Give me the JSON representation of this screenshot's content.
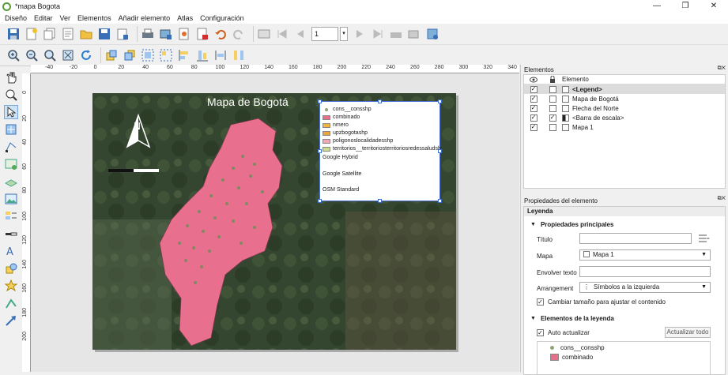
{
  "window": {
    "title": "*mapa Bogota",
    "min_glyph": "—",
    "max_glyph": "❐",
    "close_glyph": "✕"
  },
  "menu": [
    "Diseño",
    "Editar",
    "Ver",
    "Elementos",
    "Añadir elemento",
    "Atlas",
    "Configuración"
  ],
  "toolbar": {
    "page_number": "1"
  },
  "ruler": {
    "h_ticks": [
      "-40",
      "-20",
      "0",
      "20",
      "40",
      "60",
      "80",
      "100",
      "120",
      "140",
      "160",
      "180",
      "200",
      "220",
      "240",
      "260",
      "280",
      "300",
      "320",
      "340"
    ],
    "v_ticks": [
      "0",
      "20",
      "40",
      "60",
      "80",
      "100",
      "120",
      "140",
      "160",
      "180",
      "200"
    ]
  },
  "map": {
    "title": "Mapa de Bogotá",
    "north_glyph": "N",
    "legend_items": [
      {
        "label": "cons__consshp",
        "color": "#8fa47a",
        "kind": "dot"
      },
      {
        "label": "combinado",
        "color": "#e86f8a",
        "kind": "rect"
      },
      {
        "label": "nmero",
        "color": "#f0b53a",
        "kind": "rect"
      },
      {
        "label": "upzbogotashp",
        "color": "#e9a73b",
        "kind": "rect"
      },
      {
        "label": "poligonoslocalidadesshp",
        "color": "#f3a7b4",
        "kind": "rect"
      },
      {
        "label": "territorios__territoriosterritoriosredessaludsh",
        "color": "#c7dd8a",
        "kind": "rect"
      },
      {
        "label": "Google Hybrid",
        "color": "",
        "kind": "none"
      },
      {
        "label": "Google Satellite",
        "color": "",
        "kind": "none"
      },
      {
        "label": "OSM Standard",
        "color": "",
        "kind": "none"
      }
    ],
    "colors": {
      "polygon": "#e8708e",
      "satellite": "#2e3f2b",
      "scale_black": "#111111",
      "scale_white": "#ffffff"
    }
  },
  "items_panel": {
    "title": "Elementos",
    "header_label": "Elemento",
    "rows": [
      {
        "label": "<Legend>",
        "visible": true,
        "locked": false,
        "bold": true,
        "icon": "legend-icon"
      },
      {
        "label": "Mapa de Bogotá",
        "visible": true,
        "locked": false,
        "bold": false,
        "icon": "text-icon"
      },
      {
        "label": "Flecha del Norte",
        "visible": true,
        "locked": false,
        "bold": false,
        "icon": "picture-icon"
      },
      {
        "label": "<Barra de escala>",
        "visible": true,
        "locked": true,
        "bold": false,
        "icon": "scalebar-icon"
      },
      {
        "label": "Mapa 1",
        "visible": true,
        "locked": false,
        "bold": false,
        "icon": "map-icon"
      }
    ]
  },
  "props_panel": {
    "title": "Propiedades del elemento",
    "item_type": "Leyenda",
    "main_section": "Propiedades principales",
    "titulo_label": "Título",
    "titulo_value": "",
    "mapa_label": "Mapa",
    "mapa_value": "Mapa 1",
    "wrap_label": "Envolver texto",
    "wrap_value": "",
    "arrangement_label": "Arrangement",
    "arrangement_value": "Símbolos a la izquierda",
    "resize_label": "Cambiar tamaño para ajustar el contenido",
    "legend_section": "Elementos de la leyenda",
    "auto_update_label": "Auto actualizar",
    "update_all_label": "Actualizar todo",
    "legend_list": [
      "cons__consshp",
      "combinado"
    ]
  }
}
